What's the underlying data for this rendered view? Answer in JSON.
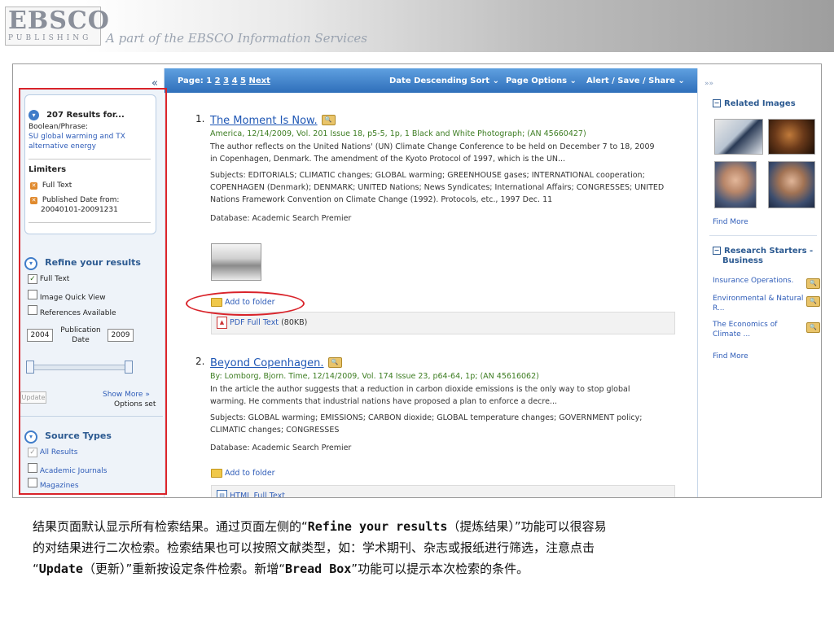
{
  "banner": {
    "logo_main": "EBSCO",
    "logo_sub": "PUBLISHING",
    "tagline": "A part of the EBSCO Information Services"
  },
  "sidebar": {
    "collapse": "«",
    "results_for": "207 Results for...",
    "boolean_label": "Boolean/Phrase:",
    "query_line1": "SU global warming and TX",
    "query_line2": "alternative energy",
    "limiters_title": "Limiters",
    "limiter1": "Full Text",
    "limiter2_line1": "Published Date from:",
    "limiter2_line2": "20040101-20091231",
    "refine_title": "Refine your results",
    "refine_opts": [
      "Full Text",
      "Image Quick View",
      "References Available"
    ],
    "pub_from": "2004",
    "pub_label_line1": "Publication",
    "pub_label_line2": "Date",
    "pub_to": "2009",
    "update_btn": "Update",
    "show_more": "Show More »",
    "options_set": "Options set",
    "source_title": "Source Types",
    "source_opts": [
      "All Results",
      "Academic Journals",
      "Magazines"
    ]
  },
  "toolbar": {
    "page_label": "Page: 1",
    "pages": [
      "2",
      "3",
      "4",
      "5"
    ],
    "next": "Next",
    "sort": "Date Descending Sort ⌄",
    "page_options": "Page Options ⌄",
    "alert_share": "Alert / Save / Share ⌄"
  },
  "results": [
    {
      "num": "1.",
      "title": "The Moment Is Now.",
      "meta": "America, 12/14/2009, Vol. 201 Issue 18, p5-5, 1p, 1 Black and White Photograph; (AN 45660427)",
      "abstract1": "The author reflects on the United Nations' (UN) Climate Change Conference to be held on December 7 to 18, 2009",
      "abstract2": "in Copenhagen, Denmark. The amendment of the Kyoto Protocol of 1997, which is the UN...",
      "subjects1": "Subjects: EDITORIALS; CLIMATIC changes; GLOBAL warming; GREENHOUSE gases; INTERNATIONAL cooperation;",
      "subjects2": "COPENHAGEN (Denmark); DENMARK; UNITED Nations; News Syndicates; International Affairs; CONGRESSES; UNITED",
      "subjects3": "Nations Framework Convention on Climate Change (1992). Protocols, etc., 1997 Dec. 11",
      "database": "Database: Academic Search Premier",
      "add_folder": "Add to folder",
      "fulltext": "PDF Full Text",
      "fulltext_size": "(80KB)"
    },
    {
      "num": "2.",
      "title": "Beyond Copenhagen.",
      "meta": "By: Lomborg, Bjorn. Time, 12/14/2009, Vol. 174 Issue 23, p64-64, 1p; (AN 45616062)",
      "abstract1": "In the article the author suggests that a reduction in carbon dioxide emissions is the only way to stop global",
      "abstract2": "warming. He comments that industrial nations have proposed a plan to enforce a decre...",
      "subjects1": "Subjects: GLOBAL warming; EMISSIONS; CARBON dioxide; GLOBAL temperature changes; GOVERNMENT policy;",
      "subjects2": "CLIMATIC changes; CONGRESSES",
      "database": "Database: Academic Search Premier",
      "add_folder": "Add to folder",
      "fulltext": "HTML Full Text"
    }
  ],
  "right_panel": {
    "expand": "»»",
    "related_images": "Related Images",
    "find_more1": "Find More",
    "research_line1": "Research Starters -",
    "research_line2": "Business",
    "starters": [
      {
        "line1": "Insurance Operations.",
        "line2": ""
      },
      {
        "line1": "Environmental & Natural",
        "line2": "R..."
      },
      {
        "line1": "The Economics of",
        "line2": "Climate ..."
      }
    ],
    "find_more2": "Find More"
  },
  "caption": {
    "l1a": "结果页面默认显示所有检索结果。通过页面左侧的“",
    "l1b": "Refine your results",
    "l1c": "（提炼结果）”功能可以很容易",
    "l2": "的对结果进行二次检索。检索结果也可以按照文献类型，如：学术期刊、杂志或报纸进行筛选，注意点击",
    "l3a": "“",
    "l3b": "Update",
    "l3c": "（更新）”重新按设定条件检索。新增“",
    "l3d": "Bread Box",
    "l3e": "”功能可以提示本次检索的条件。"
  }
}
